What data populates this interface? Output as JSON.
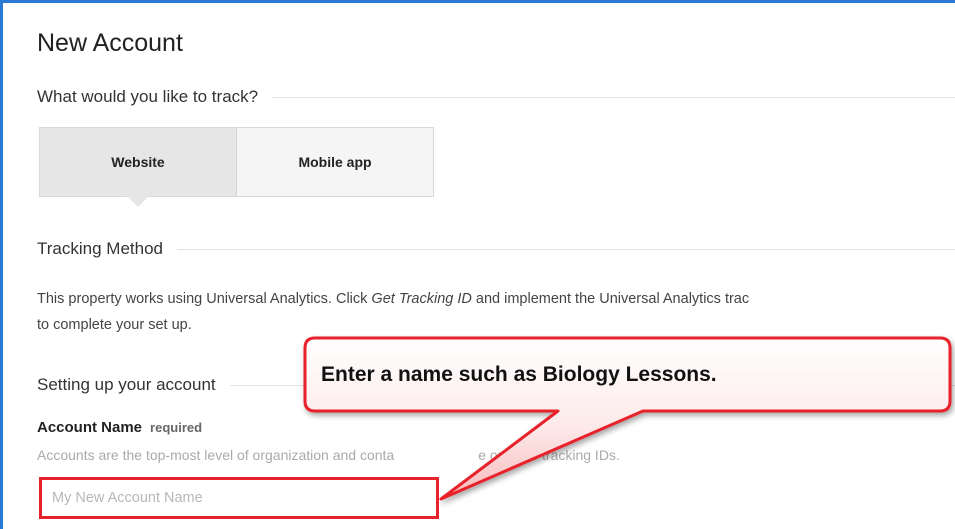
{
  "page": {
    "title": "New Account"
  },
  "track": {
    "heading": "What would you like to track?",
    "options": [
      {
        "label": "Website",
        "selected": true
      },
      {
        "label": "Mobile app",
        "selected": false
      }
    ]
  },
  "tracking_method": {
    "heading": "Tracking Method",
    "text_before": "This property works using Universal Analytics. Click ",
    "text_em": "Get Tracking ID",
    "text_after": " and implement the Universal Analytics trac",
    "text_line2": "to complete your set up."
  },
  "setup": {
    "heading": "Setting up your account",
    "account_name_label": "Account Name",
    "required_label": "required",
    "help_text": "Accounts are the top-most level of organization and conta",
    "help_text_end": "e or more tracking IDs.",
    "input_value": "",
    "input_placeholder": "My New Account Name"
  },
  "annotation": {
    "text": "Enter a name such as Biology Lessons.",
    "color": "#e8212b"
  }
}
